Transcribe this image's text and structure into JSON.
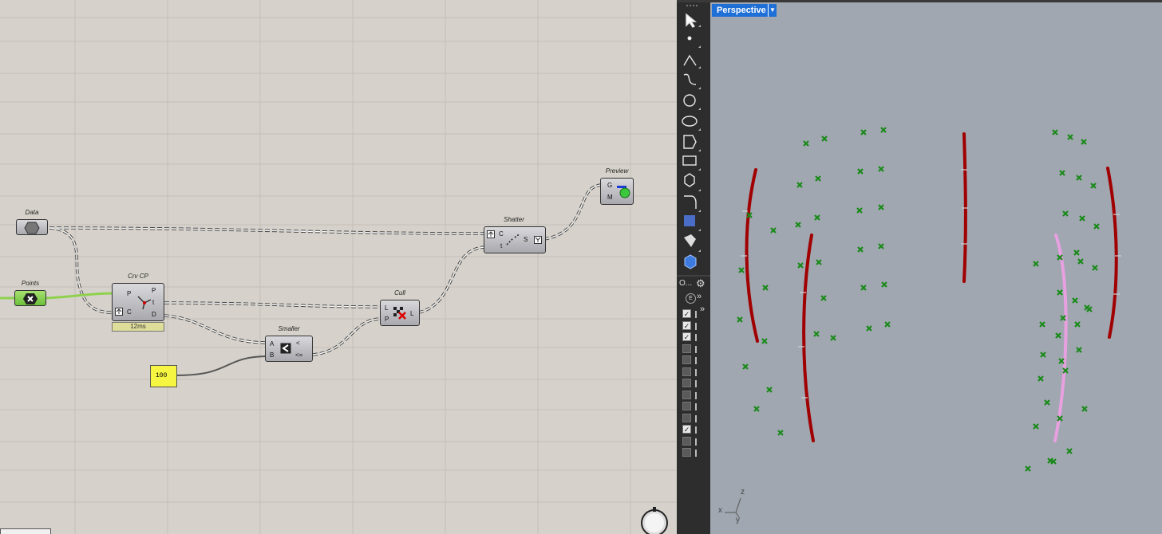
{
  "canvas": {
    "components": {
      "data": {
        "label": "Data"
      },
      "points": {
        "label": "Points"
      },
      "crvcp": {
        "label": "Crv CP",
        "inputs": [
          "P",
          "C"
        ],
        "outputs": [
          "P",
          "t",
          "D"
        ],
        "timing": "12ms"
      },
      "smaller": {
        "label": "Smaller",
        "inputs": [
          "A",
          "B"
        ],
        "outputs": [
          "<",
          "<="
        ]
      },
      "cull": {
        "label": "Cull",
        "inputs": [
          "L",
          "P"
        ],
        "outputs": [
          "L"
        ]
      },
      "shatter": {
        "label": "Shatter",
        "inputs": [
          "C",
          "t"
        ],
        "outputs": [
          "S"
        ]
      },
      "preview": {
        "label": "Preview",
        "inputs": [
          "G",
          "M"
        ]
      },
      "number": {
        "value": "100"
      }
    },
    "colors": {
      "background": "#d6d2cb",
      "grid": "#c4c0b8",
      "wire": "#444444",
      "points_wire": "#8fd14f",
      "number_fill": "#f5f542"
    }
  },
  "rhino": {
    "toolbar": {
      "icons": [
        "select-arrow-icon",
        "point-icon",
        "polyline-icon",
        "curve-icon",
        "circle-icon",
        "ellipse-icon",
        "polygon-icon",
        "rectangle-icon",
        "solid-icon",
        "fillet-icon",
        "transform-icon",
        "boolean-icon",
        "box-icon"
      ],
      "more_label": "O...",
      "settings_icon": "gear-icon",
      "expand_label": "»"
    },
    "layers": [
      true,
      true,
      true,
      false,
      false,
      false,
      false,
      false,
      false,
      false,
      true,
      false,
      false
    ],
    "viewport": {
      "title": "Perspective",
      "axis": {
        "x": "x",
        "y": "y",
        "z": "z"
      },
      "colors": {
        "curve": "#a00000",
        "highlight": "#e8a0e0",
        "point": "#1a8a1a",
        "background": "#a0a7b0"
      }
    }
  }
}
